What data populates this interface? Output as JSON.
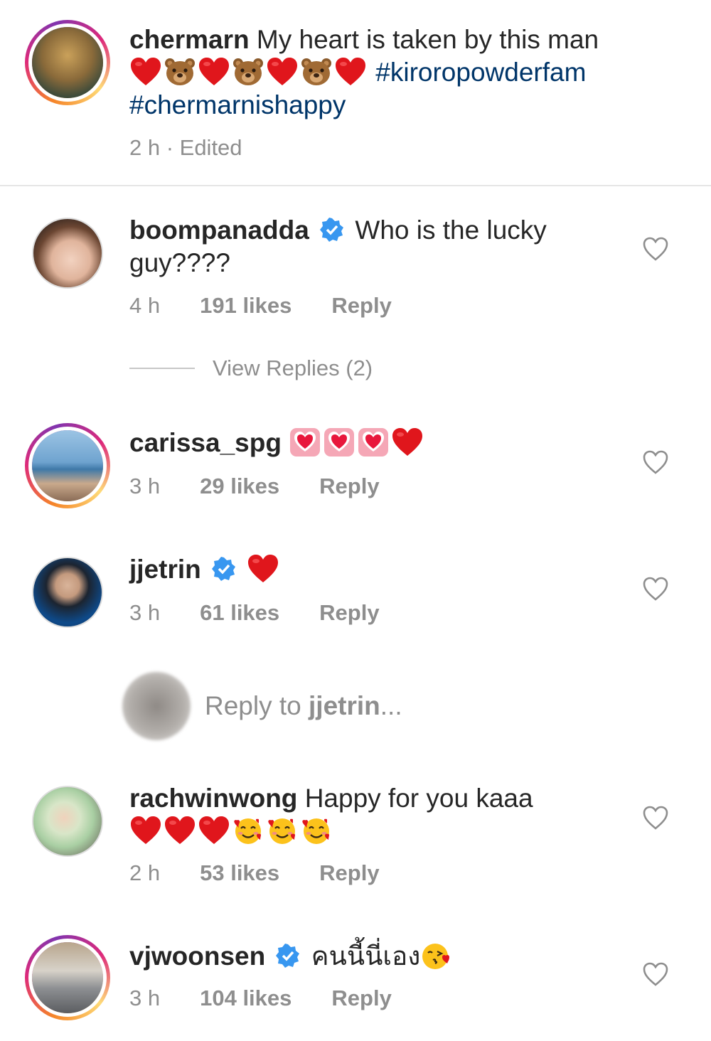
{
  "caption": {
    "username": "chermarn",
    "text": "My heart is taken by this man",
    "emojis": [
      "red-heart",
      "bear-face",
      "red-heart",
      "bear-face",
      "red-heart",
      "bear-face",
      "red-heart"
    ],
    "hashtag1": "#kiroropowderfam",
    "hashtag2": "#chermarnishappy",
    "time": "2 h · Edited"
  },
  "comments": [
    {
      "username": "boompanadda",
      "verified": true,
      "text1": "Who is the lucky",
      "text2": "guy????",
      "time": "4 h",
      "likes": "191 likes",
      "reply": "Reply"
    },
    {
      "username": "carissa_spg",
      "verified": false,
      "emojis": [
        "heart-decoration",
        "heart-decoration",
        "heart-decoration",
        "red-heart"
      ],
      "time": "3 h",
      "likes": "29 likes",
      "reply": "Reply"
    },
    {
      "username": "jjetrin",
      "verified": true,
      "emojis": [
        "red-heart"
      ],
      "time": "3 h",
      "likes": "61 likes",
      "reply": "Reply"
    },
    {
      "username": "rachwinwong",
      "verified": false,
      "text1": "Happy for you kaaa",
      "emojis": [
        "red-heart",
        "red-heart",
        "red-heart",
        "smiling-face-with-hearts",
        "smiling-face-with-hearts",
        "smiling-face-with-hearts"
      ],
      "time": "2 h",
      "likes": "53 likes",
      "reply": "Reply"
    },
    {
      "username": "vjwoonsen",
      "verified": true,
      "text1": "คนนี้นี่เอง",
      "emojis": [
        "face-blowing-kiss"
      ],
      "time": "3 h",
      "likes": "104 likes",
      "reply": "Reply"
    }
  ],
  "view_replies": "View Replies (2)",
  "reply_to": {
    "prefix": "Reply to ",
    "username": "jjetrin",
    "suffix": "..."
  },
  "colors": {
    "text": "#262626",
    "muted": "#8e8e8e",
    "hashtag": "#003569",
    "verified": "#3897f0",
    "heart": "#ed1c24"
  }
}
